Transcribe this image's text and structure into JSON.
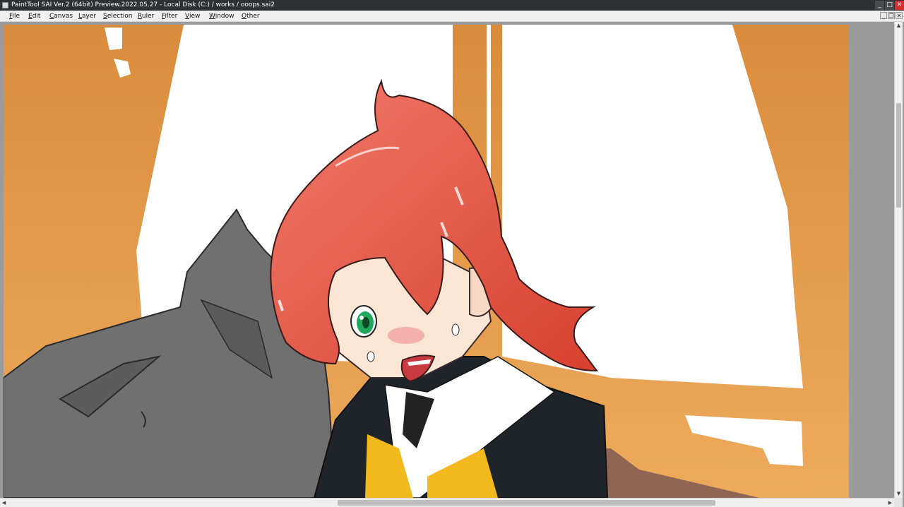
{
  "window": {
    "title": "PaintTool SAI Ver.2 (64bit) Preview.2022.05.27 - Local Disk (C:) / works / ooops.sai2",
    "buttons": {
      "minimize": "_",
      "maximize": "□",
      "close": "✕"
    }
  },
  "menubar": {
    "items": [
      {
        "first": "F",
        "rest": "ile"
      },
      {
        "first": "E",
        "rest": "dit"
      },
      {
        "first": "C",
        "rest": "anvas"
      },
      {
        "first": "L",
        "rest": "ayer"
      },
      {
        "first": "S",
        "rest": "election"
      },
      {
        "first": "R",
        "rest": "uler"
      },
      {
        "first": "F",
        "rest": "ilter"
      },
      {
        "first": "V",
        "rest": "iew"
      },
      {
        "first": "W",
        "rest": "indow"
      },
      {
        "first": "O",
        "rest": "ther"
      }
    ],
    "mdi_buttons": {
      "minimize": "_",
      "restore": "❐",
      "close": "✕"
    }
  },
  "scrollbars": {
    "up": "▲",
    "down": "▼",
    "left": "◀",
    "right": "▶"
  },
  "colors": {
    "background_orange": "#e9a351",
    "window_white": "#ffffff",
    "hair": "#e0584a",
    "eye": "#1fa85a",
    "uniform": "#1e2228",
    "scarf": "#f1b91b",
    "grey_figure": "#6f6f6f"
  },
  "icons": {
    "app": "painttool-sai-icon"
  }
}
